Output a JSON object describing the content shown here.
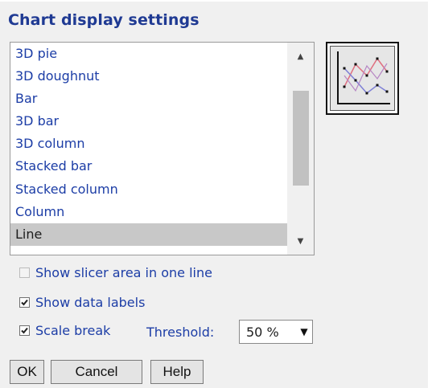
{
  "dialog": {
    "title": "Chart display settings"
  },
  "chart_types": {
    "items": [
      {
        "label": "3D pie"
      },
      {
        "label": "3D doughnut"
      },
      {
        "label": "Bar"
      },
      {
        "label": "3D bar"
      },
      {
        "label": "3D column"
      },
      {
        "label": "Stacked bar"
      },
      {
        "label": "Stacked column"
      },
      {
        "label": "Column"
      },
      {
        "label": "Line"
      }
    ],
    "selected": "Line",
    "preview_icon": "line-chart-icon"
  },
  "options": {
    "show_slicer_one_line": {
      "label": "Show slicer area in one line",
      "checked": false,
      "enabled": false
    },
    "show_data_labels": {
      "label": "Show data labels",
      "checked": true
    },
    "scale_break": {
      "label": "Scale break",
      "checked": true
    }
  },
  "threshold": {
    "label": "Threshold:",
    "value": "50 %"
  },
  "buttons": {
    "ok": "OK",
    "cancel": "Cancel",
    "help": "Help"
  },
  "colors": {
    "title": "#1f3a93",
    "text": "#1c3da6",
    "selection": "#c8c8c8",
    "background": "#f0f0f0"
  }
}
